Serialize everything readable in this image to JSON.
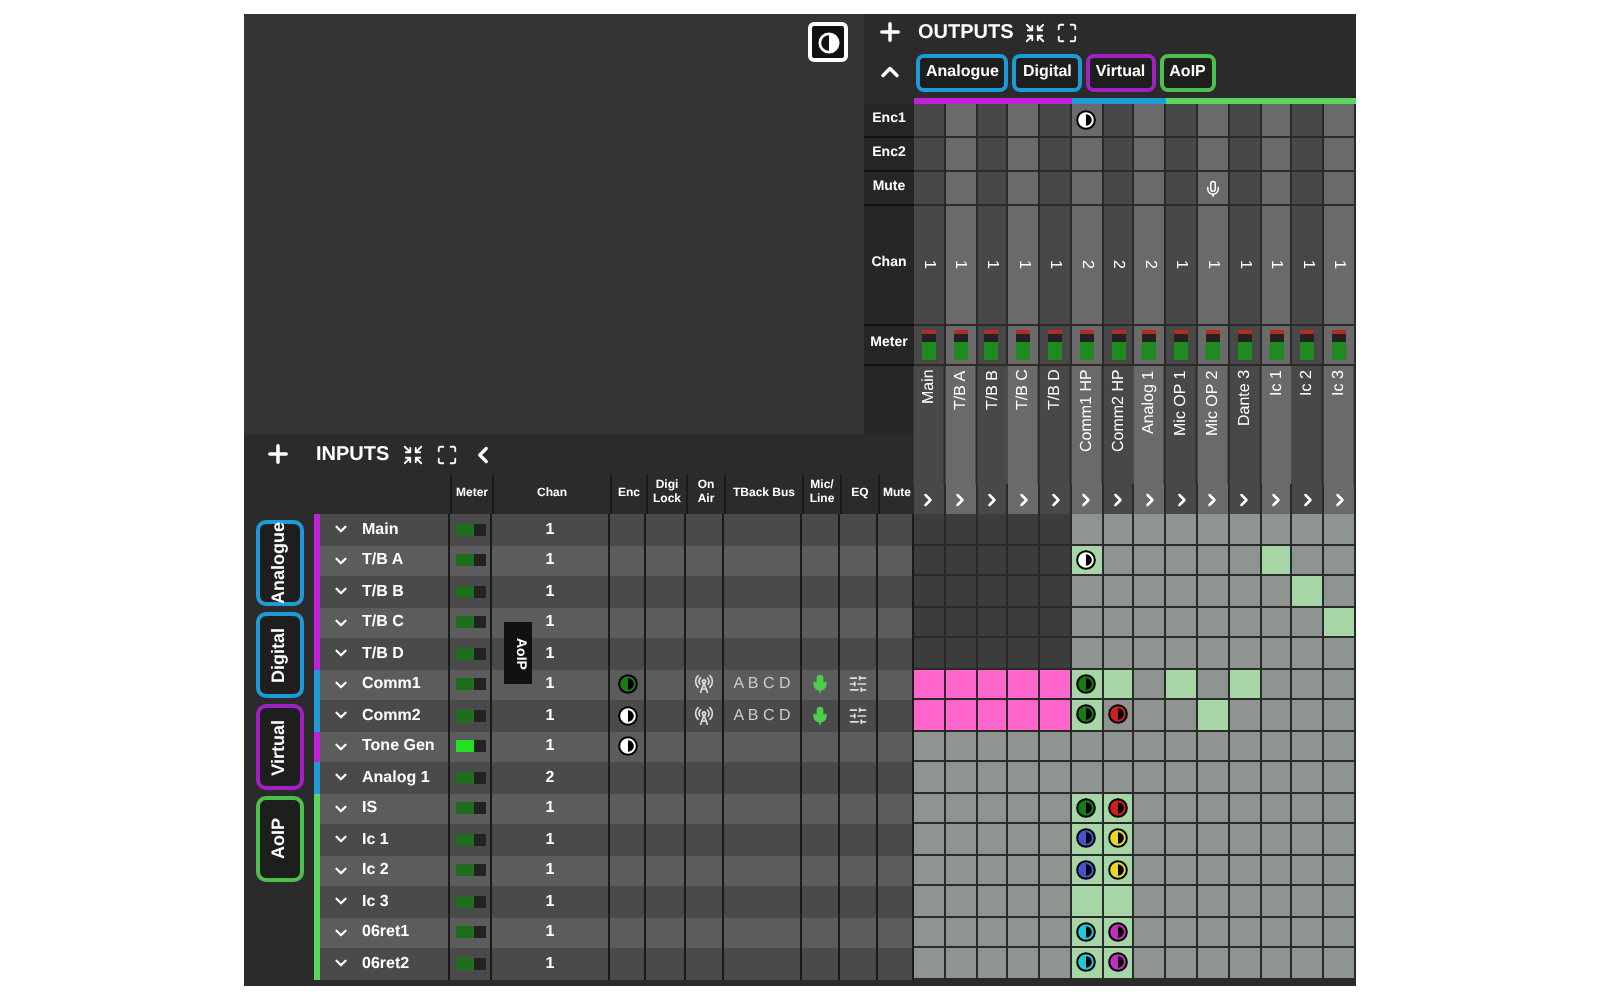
{
  "outputs": {
    "title": "OUTPUTS",
    "tabs": [
      {
        "label": "Analogue",
        "color": "#1e9ad6"
      },
      {
        "label": "Digital",
        "color": "#1e9ad6"
      },
      {
        "label": "Virtual",
        "color": "#a020c0"
      },
      {
        "label": "AoIP",
        "color": "#4cc04c"
      }
    ],
    "row_labels": [
      "Enc1",
      "Enc2",
      "Mute",
      "Chan",
      "Meter"
    ],
    "columns": [
      {
        "name": "Main",
        "chan": "1",
        "color": "#c020d8",
        "enc1": false,
        "muted": false,
        "level": 0.6
      },
      {
        "name": "T/B A",
        "chan": "1",
        "color": "#c020d8",
        "enc1": false,
        "muted": false,
        "level": 0.6
      },
      {
        "name": "T/B B",
        "chan": "1",
        "color": "#c020d8",
        "enc1": false,
        "muted": false,
        "level": 0.6
      },
      {
        "name": "T/B C",
        "chan": "1",
        "color": "#c020d8",
        "enc1": false,
        "muted": false,
        "level": 0.6
      },
      {
        "name": "T/B D",
        "chan": "1",
        "color": "#c020d8",
        "enc1": false,
        "muted": false,
        "level": 0.6
      },
      {
        "name": "Comm1 HP",
        "chan": "2",
        "color": "#1e9ad6",
        "enc1": true,
        "muted": false,
        "level": 0.6
      },
      {
        "name": "Comm2 HP",
        "chan": "2",
        "color": "#1e9ad6",
        "enc1": false,
        "muted": false,
        "level": 0.6
      },
      {
        "name": "Analog 1",
        "chan": "2",
        "color": "#1e9ad6",
        "enc1": false,
        "muted": false,
        "level": 0.6
      },
      {
        "name": "Mic OP 1",
        "chan": "1",
        "color": "#5cd65c",
        "enc1": false,
        "muted": false,
        "level": 0.6
      },
      {
        "name": "Mic OP 2",
        "chan": "1",
        "color": "#5cd65c",
        "enc1": false,
        "muted": true,
        "level": 0.6
      },
      {
        "name": "Dante 3",
        "chan": "1",
        "color": "#5cd65c",
        "enc1": false,
        "muted": false,
        "level": 0.6
      },
      {
        "name": "Ic 1",
        "chan": "1",
        "color": "#5cd65c",
        "enc1": false,
        "muted": false,
        "level": 0.6
      },
      {
        "name": "Ic 2",
        "chan": "1",
        "color": "#5cd65c",
        "enc1": false,
        "muted": false,
        "level": 0.6
      },
      {
        "name": "Ic 3",
        "chan": "1",
        "color": "#5cd65c",
        "enc1": false,
        "muted": false,
        "level": 0.6
      }
    ]
  },
  "inputs": {
    "title": "INPUTS",
    "tabs": [
      {
        "label": "Analogue",
        "color": "#1e9ad6"
      },
      {
        "label": "Digital",
        "color": "#1e9ad6"
      },
      {
        "label": "Virtual",
        "color": "#a020c0"
      },
      {
        "label": "AoIP",
        "color": "#4cc04c"
      }
    ],
    "columns": [
      "Meter",
      "Chan",
      "Enc",
      "Digi Lock",
      "On Air",
      "TBack Bus",
      "Mic/ Line",
      "EQ",
      "Mute"
    ],
    "rows": [
      {
        "name": "Main",
        "chan": "1",
        "color": "#c020d8",
        "level": 0.65,
        "active": false,
        "on_air": false,
        "mic": false,
        "eq": false,
        "cells": [
          {
            "kind": "blocked"
          },
          {
            "kind": "blocked"
          },
          {
            "kind": "blocked"
          },
          {
            "kind": "blocked"
          },
          {
            "kind": "blocked"
          },
          {
            "kind": "free"
          },
          {
            "kind": "free"
          },
          {
            "kind": "free"
          },
          {
            "kind": "free"
          },
          {
            "kind": "free"
          },
          {
            "kind": "free"
          },
          {
            "kind": "free"
          },
          {
            "kind": "free"
          },
          {
            "kind": "free"
          }
        ]
      },
      {
        "name": "T/B A",
        "chan": "1",
        "color": "#c020d8",
        "level": 0.65,
        "active": false,
        "on_air": false,
        "mic": false,
        "eq": false,
        "cells": [
          {
            "kind": "blocked"
          },
          {
            "kind": "blocked"
          },
          {
            "kind": "blocked"
          },
          {
            "kind": "blocked"
          },
          {
            "kind": "blocked"
          },
          {
            "kind": "lit",
            "color": "#ffffff"
          },
          {
            "kind": "free"
          },
          {
            "kind": "free"
          },
          {
            "kind": "free"
          },
          {
            "kind": "free"
          },
          {
            "kind": "free"
          },
          {
            "kind": "lit"
          },
          {
            "kind": "free"
          },
          {
            "kind": "free"
          }
        ]
      },
      {
        "name": "T/B B",
        "chan": "1",
        "color": "#c020d8",
        "level": 0.65,
        "active": false,
        "on_air": false,
        "mic": false,
        "eq": false,
        "cells": [
          {
            "kind": "blocked"
          },
          {
            "kind": "blocked"
          },
          {
            "kind": "blocked"
          },
          {
            "kind": "blocked"
          },
          {
            "kind": "blocked"
          },
          {
            "kind": "free"
          },
          {
            "kind": "free"
          },
          {
            "kind": "free"
          },
          {
            "kind": "free"
          },
          {
            "kind": "free"
          },
          {
            "kind": "free"
          },
          {
            "kind": "free"
          },
          {
            "kind": "lit"
          },
          {
            "kind": "free"
          }
        ]
      },
      {
        "name": "T/B C",
        "chan": "1",
        "color": "#c020d8",
        "level": 0.65,
        "active": false,
        "on_air": false,
        "mic": false,
        "eq": false,
        "cells": [
          {
            "kind": "blocked"
          },
          {
            "kind": "blocked"
          },
          {
            "kind": "blocked"
          },
          {
            "kind": "blocked"
          },
          {
            "kind": "blocked"
          },
          {
            "kind": "free"
          },
          {
            "kind": "free"
          },
          {
            "kind": "free"
          },
          {
            "kind": "free"
          },
          {
            "kind": "free"
          },
          {
            "kind": "free"
          },
          {
            "kind": "free"
          },
          {
            "kind": "free"
          },
          {
            "kind": "lit"
          }
        ]
      },
      {
        "name": "T/B D",
        "chan": "1",
        "color": "#c020d8",
        "level": 0.65,
        "active": false,
        "on_air": false,
        "mic": false,
        "eq": false,
        "cells": [
          {
            "kind": "blocked"
          },
          {
            "kind": "blocked"
          },
          {
            "kind": "blocked"
          },
          {
            "kind": "blocked"
          },
          {
            "kind": "blocked"
          },
          {
            "kind": "free"
          },
          {
            "kind": "free"
          },
          {
            "kind": "free"
          },
          {
            "kind": "free"
          },
          {
            "kind": "free"
          },
          {
            "kind": "free"
          },
          {
            "kind": "free"
          },
          {
            "kind": "free"
          },
          {
            "kind": "free"
          }
        ]
      },
      {
        "name": "Comm1",
        "chan": "1",
        "color": "#1e9ad6",
        "level": 0.65,
        "active": false,
        "enc": {
          "color": "#1a7a1a"
        },
        "on_air": true,
        "tback": "A B C D",
        "mic": true,
        "eq": true,
        "cells": [
          {
            "kind": "pink"
          },
          {
            "kind": "pink"
          },
          {
            "kind": "pink"
          },
          {
            "kind": "pink"
          },
          {
            "kind": "pink"
          },
          {
            "kind": "lit",
            "color": "#1a7a1a"
          },
          {
            "kind": "lit"
          },
          {
            "kind": "free"
          },
          {
            "kind": "lit"
          },
          {
            "kind": "free"
          },
          {
            "kind": "lit"
          },
          {
            "kind": "free"
          },
          {
            "kind": "free"
          },
          {
            "kind": "free"
          }
        ]
      },
      {
        "name": "Comm2",
        "chan": "1",
        "color": "#1e9ad6",
        "level": 0.65,
        "active": false,
        "enc": {
          "color": "#ffffff"
        },
        "on_air": true,
        "tback": "A B C D",
        "mic": true,
        "eq": true,
        "cells": [
          {
            "kind": "pink"
          },
          {
            "kind": "pink"
          },
          {
            "kind": "pink"
          },
          {
            "kind": "pink"
          },
          {
            "kind": "pink"
          },
          {
            "kind": "lit",
            "color": "#1a7a1a"
          },
          {
            "kind": "free",
            "color": "#cc2020"
          },
          {
            "kind": "free"
          },
          {
            "kind": "free"
          },
          {
            "kind": "lit"
          },
          {
            "kind": "free"
          },
          {
            "kind": "free"
          },
          {
            "kind": "free"
          },
          {
            "kind": "free"
          }
        ]
      },
      {
        "name": "Tone Gen",
        "chan": "1",
        "color": "#c020d8",
        "level": 0.65,
        "active": true,
        "enc": {
          "color": "#ffffff"
        },
        "on_air": false,
        "mic": false,
        "eq": false,
        "cells": [
          {
            "kind": "free"
          },
          {
            "kind": "free"
          },
          {
            "kind": "free"
          },
          {
            "kind": "free"
          },
          {
            "kind": "free"
          },
          {
            "kind": "free"
          },
          {
            "kind": "free"
          },
          {
            "kind": "free"
          },
          {
            "kind": "free"
          },
          {
            "kind": "free"
          },
          {
            "kind": "free"
          },
          {
            "kind": "free"
          },
          {
            "kind": "free"
          },
          {
            "kind": "free"
          }
        ]
      },
      {
        "name": "Analog 1",
        "chan": "2",
        "color": "#1e9ad6",
        "level": 0.65,
        "active": false,
        "on_air": false,
        "mic": false,
        "eq": false,
        "cells": [
          {
            "kind": "free"
          },
          {
            "kind": "free"
          },
          {
            "kind": "free"
          },
          {
            "kind": "free"
          },
          {
            "kind": "free"
          },
          {
            "kind": "free"
          },
          {
            "kind": "free"
          },
          {
            "kind": "free"
          },
          {
            "kind": "free"
          },
          {
            "kind": "free"
          },
          {
            "kind": "free"
          },
          {
            "kind": "free"
          },
          {
            "kind": "free"
          },
          {
            "kind": "free"
          }
        ]
      },
      {
        "name": "IS",
        "chan": "1",
        "color": "#5cd65c",
        "level": 0.65,
        "active": false,
        "on_air": false,
        "mic": false,
        "eq": false,
        "cells": [
          {
            "kind": "free"
          },
          {
            "kind": "free"
          },
          {
            "kind": "free"
          },
          {
            "kind": "free"
          },
          {
            "kind": "free"
          },
          {
            "kind": "lit",
            "color": "#1a7a1a"
          },
          {
            "kind": "lit",
            "color": "#cc2020"
          },
          {
            "kind": "free"
          },
          {
            "kind": "free"
          },
          {
            "kind": "free"
          },
          {
            "kind": "free"
          },
          {
            "kind": "free"
          },
          {
            "kind": "free"
          },
          {
            "kind": "free"
          }
        ]
      },
      {
        "name": "Ic 1",
        "chan": "1",
        "color": "#5cd65c",
        "level": 0.65,
        "active": false,
        "on_air": false,
        "mic": false,
        "eq": false,
        "cells": [
          {
            "kind": "free"
          },
          {
            "kind": "free"
          },
          {
            "kind": "free"
          },
          {
            "kind": "free"
          },
          {
            "kind": "free"
          },
          {
            "kind": "lit",
            "color": "#4455cc"
          },
          {
            "kind": "lit",
            "color": "#e8d820"
          },
          {
            "kind": "free"
          },
          {
            "kind": "free"
          },
          {
            "kind": "free"
          },
          {
            "kind": "free"
          },
          {
            "kind": "free"
          },
          {
            "kind": "free"
          },
          {
            "kind": "free"
          }
        ]
      },
      {
        "name": "Ic 2",
        "chan": "1",
        "color": "#5cd65c",
        "level": 0.65,
        "active": false,
        "on_air": false,
        "mic": false,
        "eq": false,
        "cells": [
          {
            "kind": "free"
          },
          {
            "kind": "free"
          },
          {
            "kind": "free"
          },
          {
            "kind": "free"
          },
          {
            "kind": "free"
          },
          {
            "kind": "lit",
            "color": "#4455cc"
          },
          {
            "kind": "lit",
            "color": "#e8d820"
          },
          {
            "kind": "free"
          },
          {
            "kind": "free"
          },
          {
            "kind": "free"
          },
          {
            "kind": "free"
          },
          {
            "kind": "free"
          },
          {
            "kind": "free"
          },
          {
            "kind": "free"
          }
        ]
      },
      {
        "name": "Ic 3",
        "chan": "1",
        "color": "#5cd65c",
        "level": 0.65,
        "active": false,
        "on_air": false,
        "mic": false,
        "eq": false,
        "cells": [
          {
            "kind": "free"
          },
          {
            "kind": "free"
          },
          {
            "kind": "free"
          },
          {
            "kind": "free"
          },
          {
            "kind": "free"
          },
          {
            "kind": "lit"
          },
          {
            "kind": "lit"
          },
          {
            "kind": "free"
          },
          {
            "kind": "free"
          },
          {
            "kind": "free"
          },
          {
            "kind": "free"
          },
          {
            "kind": "free"
          },
          {
            "kind": "free"
          },
          {
            "kind": "free"
          }
        ]
      },
      {
        "name": "06ret1",
        "chan": "1",
        "color": "#5cd65c",
        "level": 0.65,
        "active": false,
        "on_air": false,
        "mic": false,
        "eq": false,
        "cells": [
          {
            "kind": "free"
          },
          {
            "kind": "free"
          },
          {
            "kind": "free"
          },
          {
            "kind": "free"
          },
          {
            "kind": "free"
          },
          {
            "kind": "lit",
            "color": "#20c8d8"
          },
          {
            "kind": "lit",
            "color": "#c030c0"
          },
          {
            "kind": "free"
          },
          {
            "kind": "free"
          },
          {
            "kind": "free"
          },
          {
            "kind": "free"
          },
          {
            "kind": "free"
          },
          {
            "kind": "free"
          },
          {
            "kind": "free"
          }
        ]
      },
      {
        "name": "06ret2",
        "chan": "1",
        "color": "#5cd65c",
        "level": 0.65,
        "active": false,
        "on_air": false,
        "mic": false,
        "eq": false,
        "cells": [
          {
            "kind": "free"
          },
          {
            "kind": "free"
          },
          {
            "kind": "free"
          },
          {
            "kind": "free"
          },
          {
            "kind": "free"
          },
          {
            "kind": "lit",
            "color": "#20c8d8"
          },
          {
            "kind": "lit",
            "color": "#c030c0"
          },
          {
            "kind": "free"
          },
          {
            "kind": "free"
          },
          {
            "kind": "free"
          },
          {
            "kind": "free"
          },
          {
            "kind": "free"
          },
          {
            "kind": "free"
          },
          {
            "kind": "free"
          }
        ]
      }
    ]
  },
  "drag_ghost": {
    "label": "AoIP"
  }
}
